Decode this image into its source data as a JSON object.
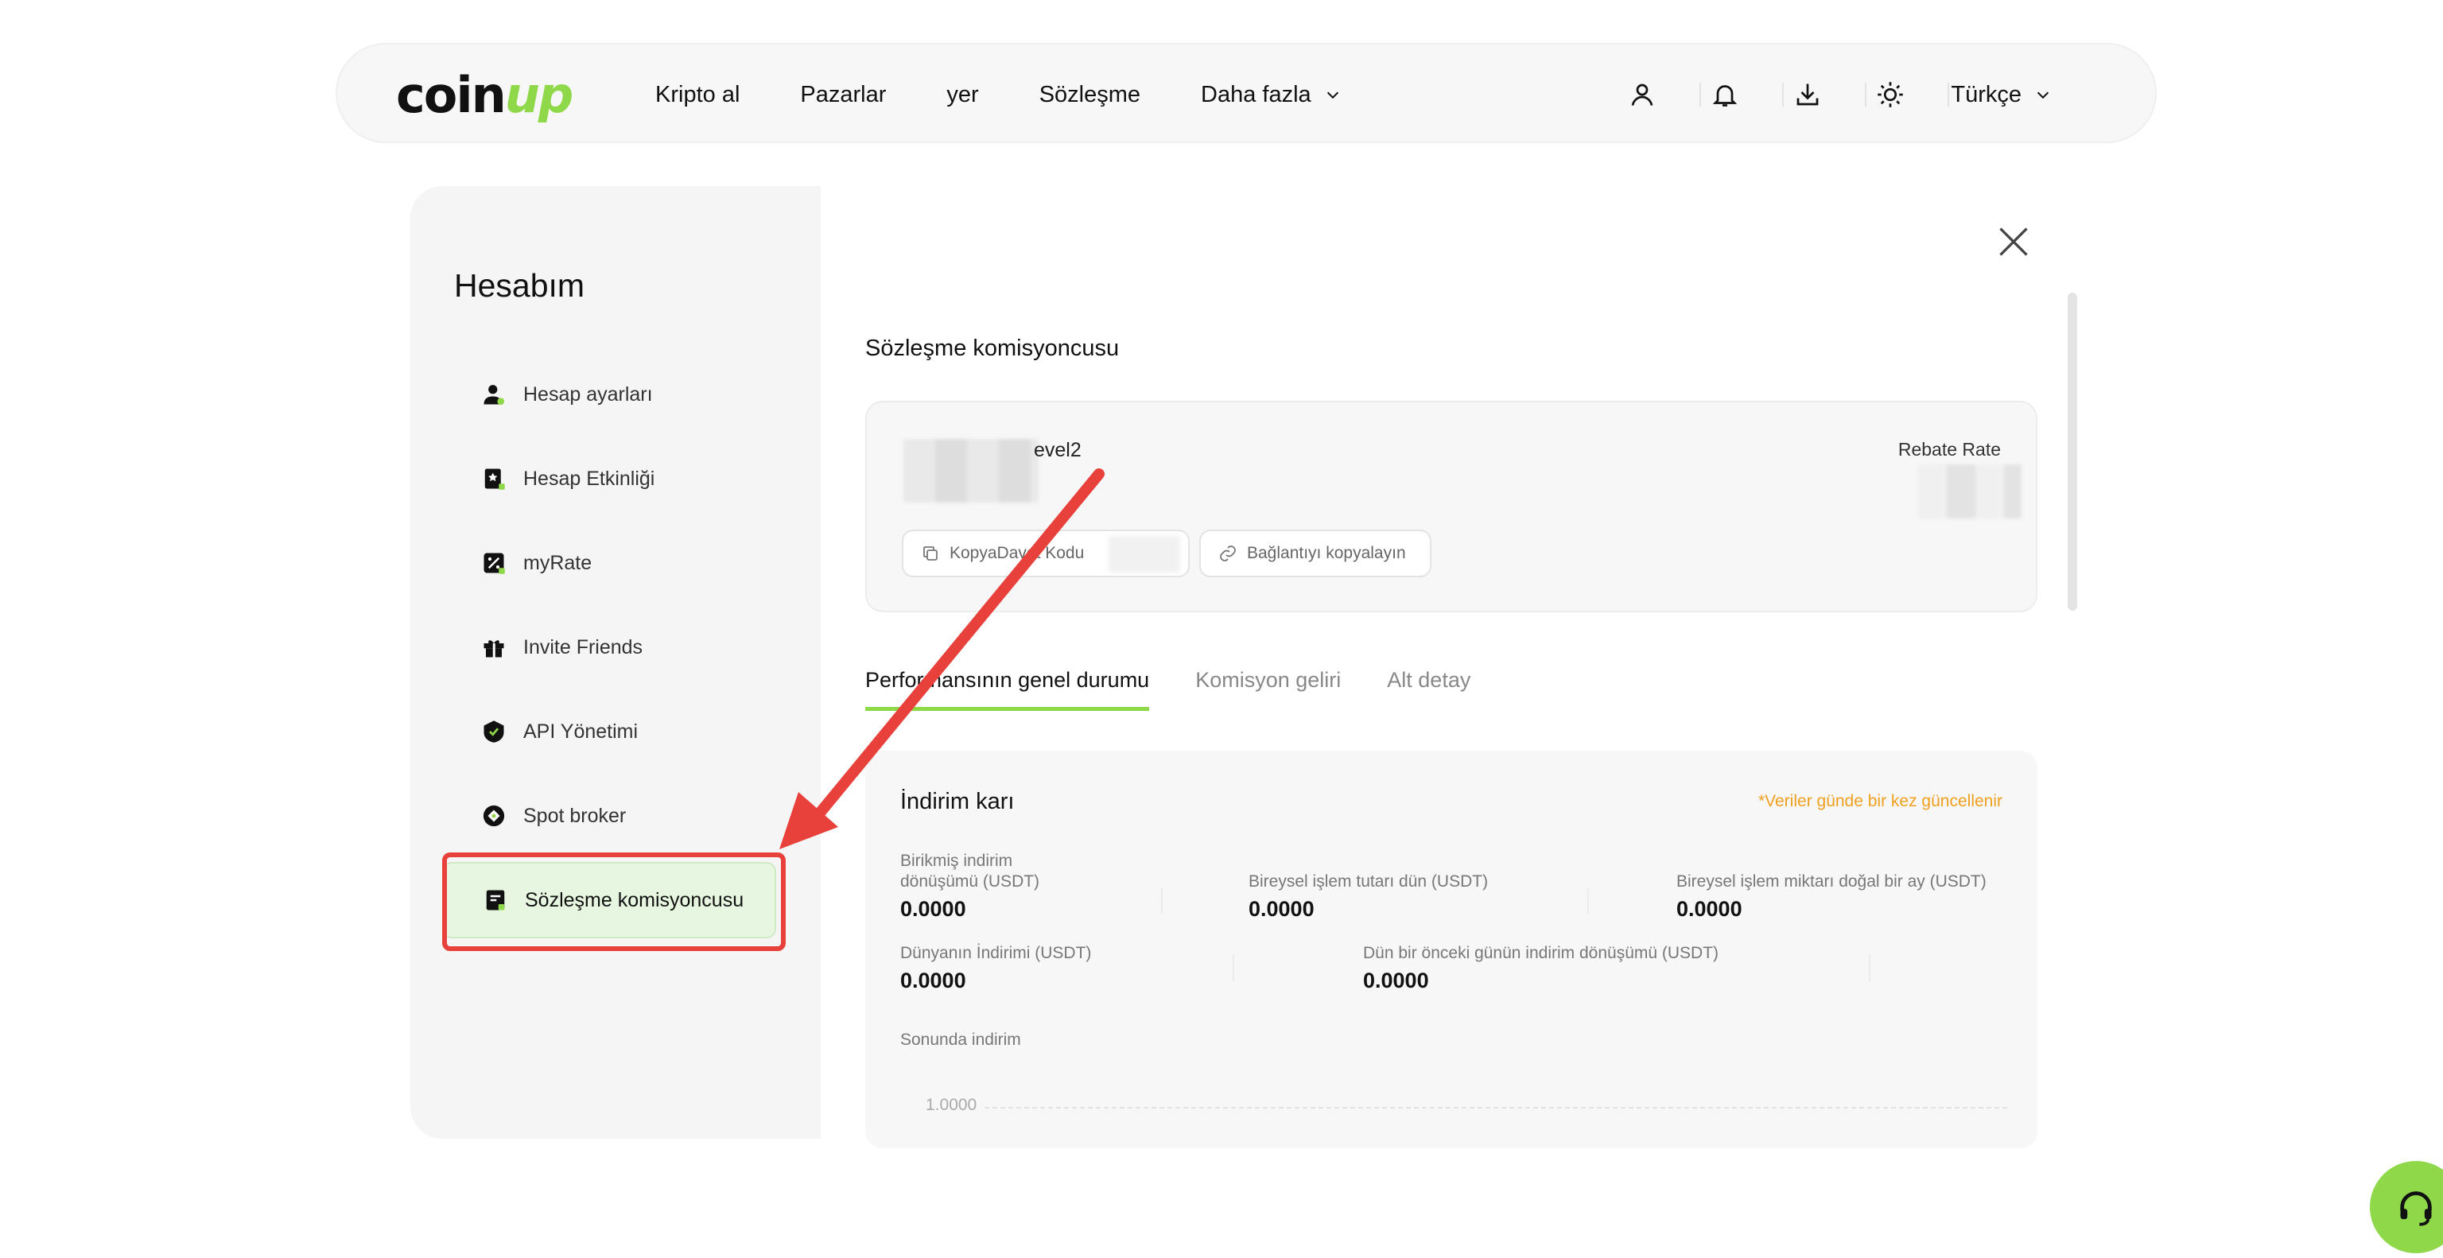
{
  "brand": {
    "name_prefix": "coin",
    "name_suffix": "up",
    "accent": "#8fd84a"
  },
  "nav": {
    "links": [
      "Kripto al",
      "Pazarlar",
      "yer",
      "Sözleşme",
      "Daha fazla"
    ],
    "icons": [
      "user-icon",
      "bell-icon",
      "download-icon",
      "sun-icon"
    ],
    "language": "Türkçe"
  },
  "sidebar": {
    "title": "Hesabım",
    "items": [
      {
        "label": "Hesap ayarları",
        "icon": "user-settings-icon"
      },
      {
        "label": "Hesap Etkinliği",
        "icon": "activity-icon"
      },
      {
        "label": "myRate",
        "icon": "percent-icon"
      },
      {
        "label": "Invite Friends",
        "icon": "gift-icon"
      },
      {
        "label": "API Yönetimi",
        "icon": "api-shield-icon"
      },
      {
        "label": "Spot broker",
        "icon": "spot-broker-icon"
      },
      {
        "label": "Sözleşme komisyoncusu",
        "icon": "contract-icon",
        "active": true
      }
    ]
  },
  "main": {
    "title": "Sözleşme komisyoncusu",
    "account": {
      "level": "evel2",
      "rebate_label": "Rebate Rate",
      "copy_code_label": "KopyaDavet Kodu",
      "copy_link_label": "Bağlantıyı kopyalayın"
    },
    "tabs": [
      {
        "label": "Performansının genel durumu",
        "active": true
      },
      {
        "label": "Komisyon geliri"
      },
      {
        "label": "Alt detay"
      }
    ],
    "summary": {
      "title": "İndirim karı",
      "note": "*Veriler günde bir kez güncellenir",
      "stats": [
        {
          "label_line1": "Birikmiş indirim",
          "label_line2": "dönüşümü (USDT)",
          "value": "0.0000"
        },
        {
          "label_line1": "Bireysel işlem tutarı dün (USDT)",
          "value": "0.0000"
        },
        {
          "label_line1": "Bireysel işlem miktarı doğal bir ay (USDT)",
          "value": "0.0000"
        },
        {
          "label_line1": "Dünyanın İndirimi (USDT)",
          "value": "0.0000"
        },
        {
          "label_line1": "Dün bir önceki günün indirim dönüşümü (USDT)",
          "value": "0.0000"
        }
      ],
      "chart_label": "Sonunda indirim",
      "chart_tick": "1.0000"
    }
  },
  "colors": {
    "highlight": "#e8403a",
    "note": "#f0a020"
  }
}
